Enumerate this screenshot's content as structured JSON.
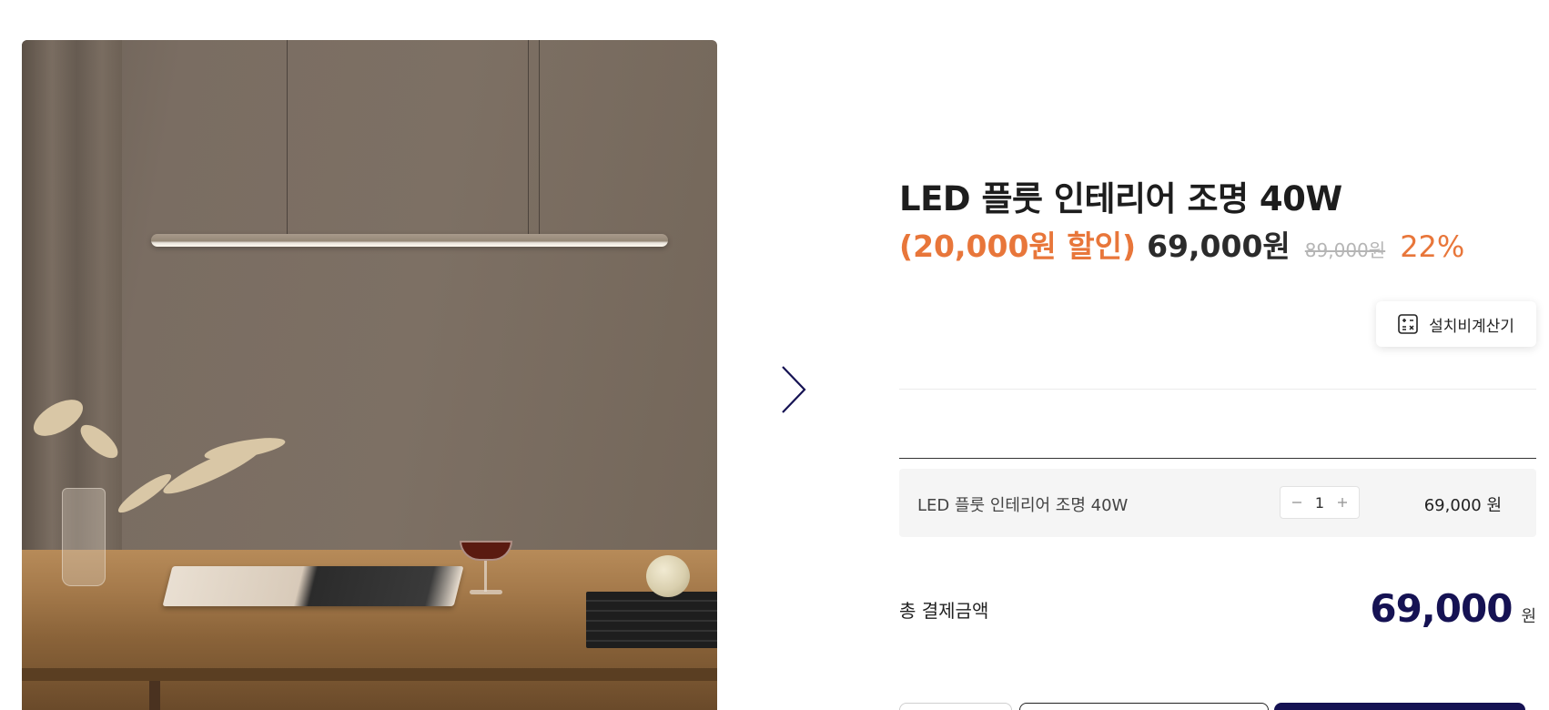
{
  "product": {
    "title": "LED 플룻 인테리어 조명 40W",
    "discount_text": "(20,000원 할인)",
    "sale_price": "69,000원",
    "original_price": "89,000원",
    "discount_rate": "22%"
  },
  "install_calc": {
    "label": "설치비계산기",
    "icon": "calculator-icon"
  },
  "options": [
    {
      "name": "LED 플룻 인테리어 조명 40W",
      "quantity": "1",
      "price": "69,000 원"
    }
  ],
  "total": {
    "label": "총 결제금액",
    "value": "69,000",
    "unit": "원"
  },
  "colors": {
    "accent_orange": "#e8763a",
    "brand_navy": "#151253",
    "strike_gray": "#b5b5b5"
  }
}
